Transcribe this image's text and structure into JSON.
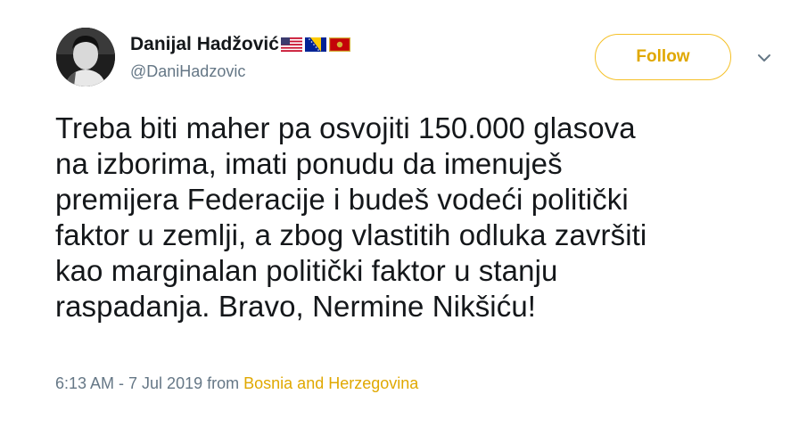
{
  "user": {
    "display_name": "Danijal Hadžović",
    "handle": "@DaniHadzovic",
    "flags": [
      "us-flag-icon",
      "bosnia-flag-icon",
      "montenegro-flag-icon"
    ]
  },
  "follow_button": {
    "label": "Follow"
  },
  "tweet": {
    "lines": [
      "Treba biti maher pa osvojiti 150.000 glasova",
      "na izborima, imati ponudu da imenuješ",
      "premijera Federacije i budeš vodeći politički",
      "faktor u zemlji, a zbog vlastitih odluka završiti",
      "kao marginalan politički faktor u stanju",
      "raspadanja. Bravo, Nermine Nikšiću!"
    ],
    "timestamp": "6:13 AM - 7 Jul 2019",
    "from_label": "from",
    "location": "Bosnia and Herzegovina"
  },
  "colors": {
    "accent": "#e0a800",
    "secondary_text": "#657786",
    "primary_text": "#14171a"
  }
}
